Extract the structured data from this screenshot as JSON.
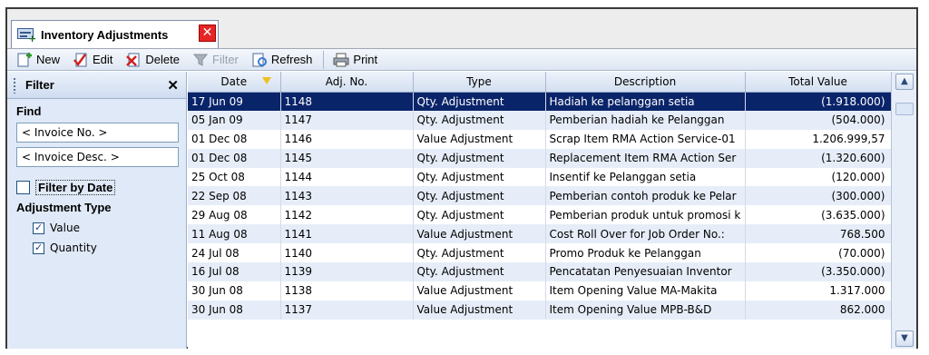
{
  "tab": {
    "title": "Inventory Adjustments",
    "close_glyph": "✕"
  },
  "toolbar": {
    "new": "New",
    "edit": "Edit",
    "delete": "Delete",
    "filter": "Filter",
    "refresh": "Refresh",
    "print": "Print"
  },
  "filter_panel": {
    "title": "Filter",
    "close_glyph": "✕",
    "find_label": "Find",
    "invoice_no_placeholder": "< Invoice No. >",
    "invoice_desc_placeholder": "< Invoice Desc. >",
    "filter_by_date_label": "Filter by Date",
    "filter_by_date_checked": false,
    "adjustment_type_label": "Adjustment Type",
    "value_label": "Value",
    "value_checked": true,
    "quantity_label": "Quantity",
    "quantity_checked": true
  },
  "grid": {
    "columns": [
      "Date",
      "Adj. No.",
      "Type",
      "Description",
      "Total Value"
    ],
    "sorted_column": "Date",
    "selected_row": 0,
    "rows": [
      [
        "17 Jun 09",
        "1148",
        "Qty. Adjustment",
        "Hadiah ke pelanggan setia",
        "(1.918.000)"
      ],
      [
        "05 Jan 09",
        "1147",
        "Qty. Adjustment",
        "Pemberian hadiah ke Pelanggan",
        "(504.000)"
      ],
      [
        "01 Dec 08",
        "1146",
        "Value Adjustment",
        "Scrap Item RMA Action Service-01",
        "1.206.999,57"
      ],
      [
        "01 Dec 08",
        "1145",
        "Qty. Adjustment",
        "Replacement Item RMA Action Ser",
        "(1.320.600)"
      ],
      [
        "25 Oct 08",
        "1144",
        "Qty. Adjustment",
        "Insentif ke Pelanggan setia",
        "(120.000)"
      ],
      [
        "22 Sep 08",
        "1143",
        "Qty. Adjustment",
        "Pemberian contoh produk ke Pelar",
        "(300.000)"
      ],
      [
        "29 Aug 08",
        "1142",
        "Qty. Adjustment",
        "Pemberian produk untuk promosi k",
        "(3.635.000)"
      ],
      [
        "11 Aug 08",
        "1141",
        "Value Adjustment",
        "Cost Roll Over for Job Order No.:",
        "768.500"
      ],
      [
        "24 Jul 08",
        "1140",
        "Qty. Adjustment",
        "Promo Produk ke Pelanggan",
        "(70.000)"
      ],
      [
        "16 Jul 08",
        "1139",
        "Qty. Adjustment",
        "Pencatatan Penyesuaian Inventor",
        "(3.350.000)"
      ],
      [
        "30 Jun 08",
        "1138",
        "Value Adjustment",
        "Item Opening Value MA-Makita",
        "1.317.000"
      ],
      [
        "30 Jun 08",
        "1137",
        "Value Adjustment",
        "Item Opening Value MPB-B&D",
        "862.000"
      ]
    ]
  },
  "colors": {
    "selection": "#0a246a",
    "panel": "#dfe9f7",
    "alt_row": "#e6edf8"
  }
}
